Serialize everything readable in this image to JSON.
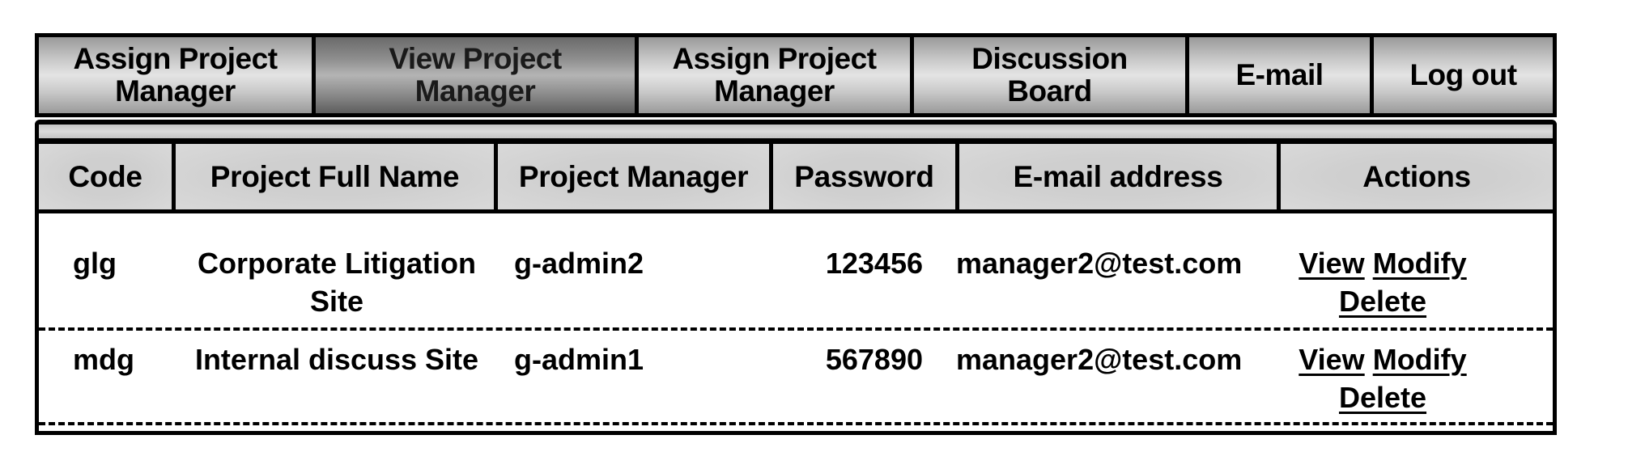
{
  "tabs": [
    {
      "label_line1": "Assign Project",
      "label_line2": "Manager",
      "active": false
    },
    {
      "label_line1": "View Project",
      "label_line2": "Manager",
      "active": true
    },
    {
      "label_line1": "Assign Project",
      "label_line2": "Manager",
      "active": false
    },
    {
      "label_line1": "Discussion",
      "label_line2": "Board",
      "active": false
    },
    {
      "label_line1": "E-mail",
      "label_line2": "",
      "active": false
    },
    {
      "label_line1": "Log out",
      "label_line2": "",
      "active": false
    }
  ],
  "table": {
    "columns": [
      "Code",
      "Project Full Name",
      "Project Manager",
      "Password",
      "E-mail address",
      "Actions"
    ],
    "rows": [
      {
        "code": "glg",
        "full_name": "Corporate Litigation Site",
        "manager": "g-admin2",
        "password": "123456",
        "email": "manager2@test.com",
        "actions": {
          "view": "View",
          "modify": "Modify",
          "delete": "Delete"
        }
      },
      {
        "code": "mdg",
        "full_name": "Internal discuss Site",
        "manager": "g-admin1",
        "password": "567890",
        "email": "manager2@test.com",
        "actions": {
          "view": "View",
          "modify": "Modify",
          "delete": "Delete"
        }
      }
    ]
  }
}
